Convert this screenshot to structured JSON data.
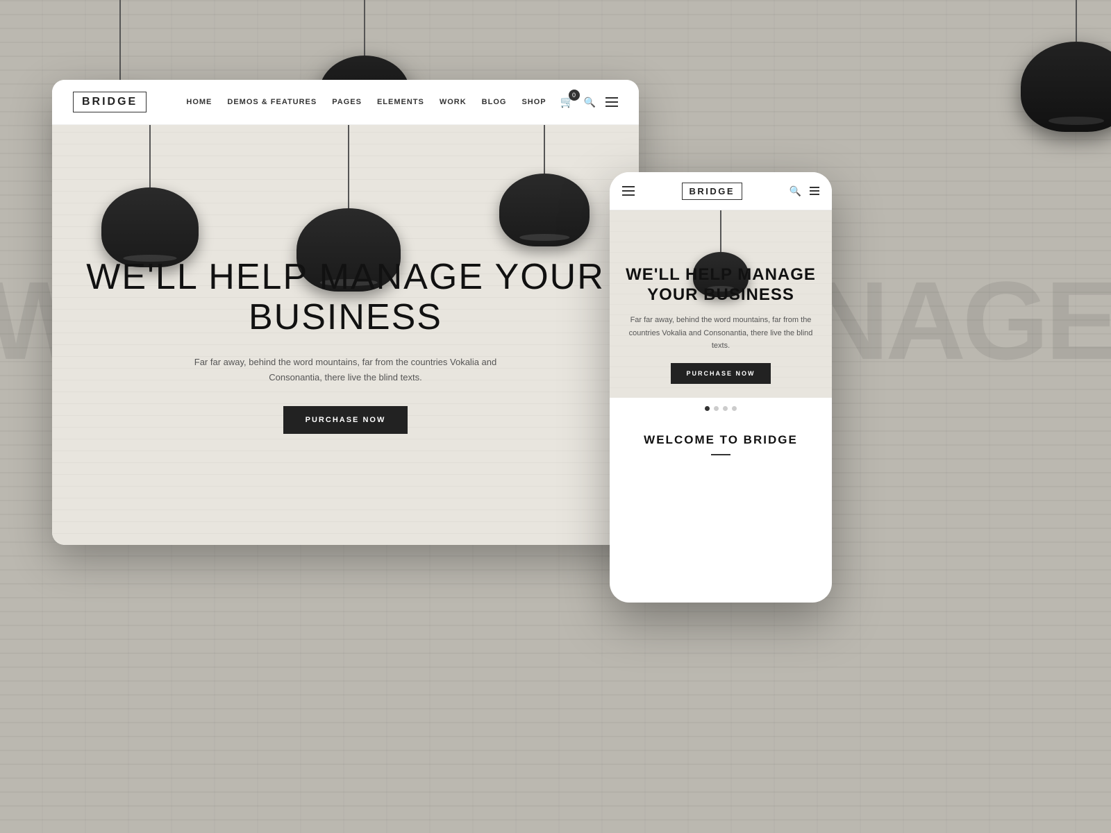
{
  "background": {
    "text": "WE'LL HELP MANAGE YOUR BUSINESS"
  },
  "desktop": {
    "logo": "BRIDGE",
    "nav": {
      "items": [
        {
          "label": "HOME"
        },
        {
          "label": "DEMOS & FEATURES"
        },
        {
          "label": "PAGES"
        },
        {
          "label": "ELEMENTS"
        },
        {
          "label": "WORK"
        },
        {
          "label": "BLOG"
        },
        {
          "label": "SHOP"
        }
      ],
      "cart_count": "0"
    },
    "hero": {
      "title": "WE'LL HELP MANAGE YOUR BUSINESS",
      "subtitle": "Far far away, behind the word mountains, far from the countries Vokalia and Consonantia, there live the blind texts.",
      "cta_button": "PURCHASE NOW"
    }
  },
  "mobile": {
    "logo": "BRIDGE",
    "hero": {
      "title": "WE'LL HELP MANAGE YOUR BUSINESS",
      "subtitle": "Far far away, behind the word mountains, far from the countries Vokalia and Consonantia, there live the blind texts.",
      "cta_button": "PURCHASE NOW"
    },
    "dots": [
      {
        "active": true
      },
      {
        "active": false
      },
      {
        "active": false
      },
      {
        "active": false
      }
    ],
    "welcome": {
      "title": "WELCOME TO BRIDGE"
    }
  }
}
